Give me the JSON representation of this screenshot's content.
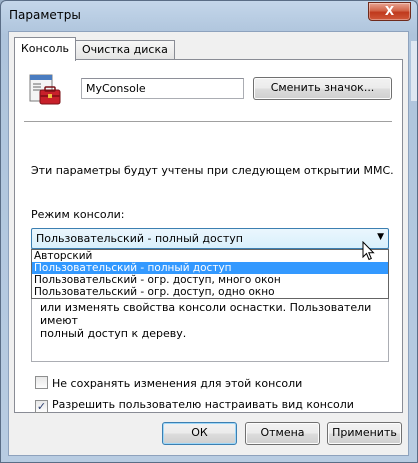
{
  "window": {
    "title": "Параметры",
    "close_glyph": "X"
  },
  "tabs": [
    {
      "label": "Консоль",
      "active": true
    },
    {
      "label": "Очистка диска",
      "active": false
    }
  ],
  "console": {
    "name_value": "MyConsole",
    "change_icon_label": "Сменить значок...",
    "info_text": "Эти параметры будут учтены при следующем открытии MMC.",
    "mode_label": "Режим консоли:",
    "mode_selected": "Пользовательский - полный доступ",
    "mode_options": [
      "Авторский",
      "Пользовательский - полный доступ",
      "Пользовательский - огр. доступ, много окон",
      "Пользовательский - огр. доступ, одно окно"
    ],
    "description_line1": "или изменять свойства консоли оснастки. Пользователи имеют",
    "description_line2": "полный доступ к дереву.",
    "checkbox_no_save": {
      "label": "Не сохранять изменения для этой консоли",
      "checked": false
    },
    "checkbox_allow_view": {
      "label": "Разрешить пользователю настраивать вид консоли",
      "checked": true
    }
  },
  "buttons": {
    "ok": "ОК",
    "cancel": "Отмена",
    "apply": "Применить"
  },
  "colors": {
    "selection": "#3399ff",
    "title_bar": "#b9cde4",
    "close_button": "#c0391d"
  }
}
